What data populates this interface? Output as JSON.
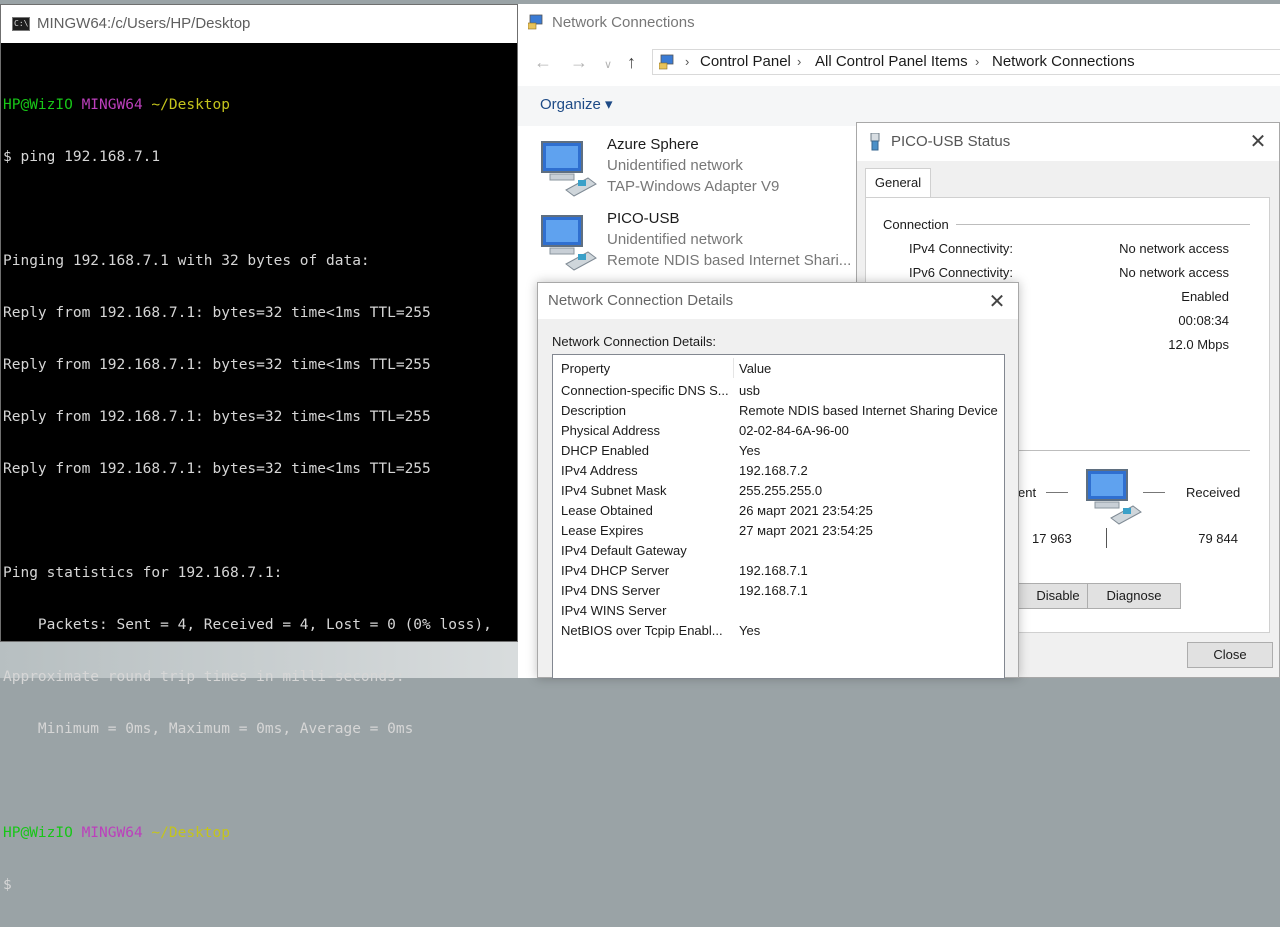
{
  "terminal": {
    "title": "MINGW64:/c/Users/HP/Desktop",
    "prompt1": {
      "user": "HP@WizIO",
      "shell": "MINGW64",
      "path": "~/Desktop"
    },
    "cmd": "$ ping 192.168.7.1",
    "out_lines": [
      "Pinging 192.168.7.1 with 32 bytes of data:",
      "Reply from 192.168.7.1: bytes=32 time<1ms TTL=255",
      "Reply from 192.168.7.1: bytes=32 time<1ms TTL=255",
      "Reply from 192.168.7.1: bytes=32 time<1ms TTL=255",
      "Reply from 192.168.7.1: bytes=32 time<1ms TTL=255"
    ],
    "stats_lines": [
      "Ping statistics for 192.168.7.1:",
      "    Packets: Sent = 4, Received = 4, Lost = 0 (0% loss),",
      "Approximate round trip times in milli-seconds:",
      "    Minimum = 0ms, Maximum = 0ms, Average = 0ms"
    ],
    "prompt2": {
      "user": "HP@WizIO",
      "shell": "MINGW64",
      "path": "~/Desktop"
    },
    "cursor_line": "$"
  },
  "explorer": {
    "title": "Network Connections",
    "breadcrumb": [
      "Control Panel",
      "All Control Panel Items",
      "Network Connections"
    ],
    "organize": "Organize ▾",
    "connections": [
      {
        "name": "Azure Sphere",
        "status": "Unidentified network",
        "adapter": "TAP-Windows Adapter V9"
      },
      {
        "name": "PICO-USB",
        "status": "Unidentified network",
        "adapter": "Remote NDIS based Internet Shari..."
      }
    ]
  },
  "status_dialog": {
    "title": "PICO-USB Status",
    "tab": "General",
    "connection_group": "Connection",
    "rows": [
      {
        "label": "IPv4 Connectivity:",
        "value": "No network access"
      },
      {
        "label": "IPv6 Connectivity:",
        "value": "No network access"
      },
      {
        "label": "",
        "value": "Enabled"
      },
      {
        "label": "",
        "value": "00:08:34"
      },
      {
        "label": "",
        "value": "12.0 Mbps"
      }
    ],
    "activity": {
      "sent_label": "ent",
      "received_label": "Received",
      "sent_value": "17 963",
      "received_value": "79 844"
    },
    "buttons": {
      "disable": "Disable",
      "diagnose": "Diagnose",
      "close": "Close"
    }
  },
  "details_dialog": {
    "title": "Network Connection Details",
    "label": "Network Connection Details:",
    "columns": [
      "Property",
      "Value"
    ],
    "rows": [
      {
        "property": "Connection-specific DNS S...",
        "value": "usb"
      },
      {
        "property": "Description",
        "value": "Remote NDIS based Internet Sharing Device"
      },
      {
        "property": "Physical Address",
        "value": "02-02-84-6A-96-00"
      },
      {
        "property": "DHCP Enabled",
        "value": "Yes"
      },
      {
        "property": "IPv4 Address",
        "value": "192.168.7.2"
      },
      {
        "property": "IPv4 Subnet Mask",
        "value": "255.255.255.0"
      },
      {
        "property": "Lease Obtained",
        "value": "26 март 2021 23:54:25"
      },
      {
        "property": "Lease Expires",
        "value": "27 март 2021 23:54:25"
      },
      {
        "property": "IPv4 Default Gateway",
        "value": ""
      },
      {
        "property": "IPv4 DHCP Server",
        "value": "192.168.7.1"
      },
      {
        "property": "IPv4 DNS Server",
        "value": "192.168.7.1"
      },
      {
        "property": "IPv4 WINS Server",
        "value": ""
      },
      {
        "property": "NetBIOS over Tcpip Enabl...",
        "value": "Yes"
      }
    ]
  }
}
